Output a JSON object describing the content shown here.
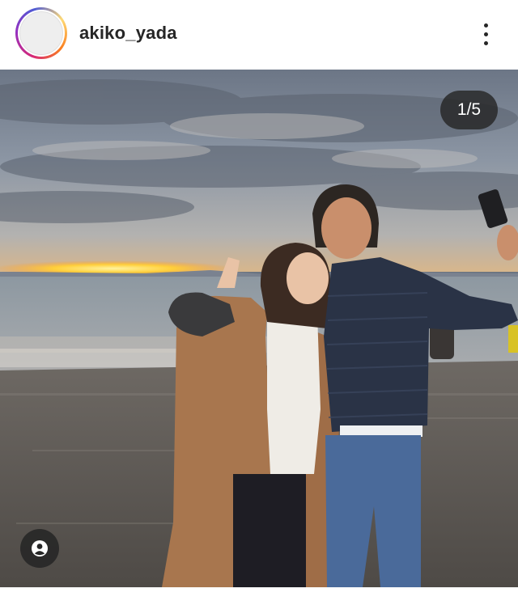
{
  "post": {
    "username": "akiko_yada",
    "carousel_position": "1/5",
    "more_icon": "more-vertical-icon",
    "tags_icon": "user-tag-icon"
  },
  "colors": {
    "story_ring": [
      "#feda75",
      "#fa7e1e",
      "#d62976",
      "#962fbf",
      "#4f5bd5"
    ],
    "text": "#262626",
    "overlay": "#262626"
  }
}
